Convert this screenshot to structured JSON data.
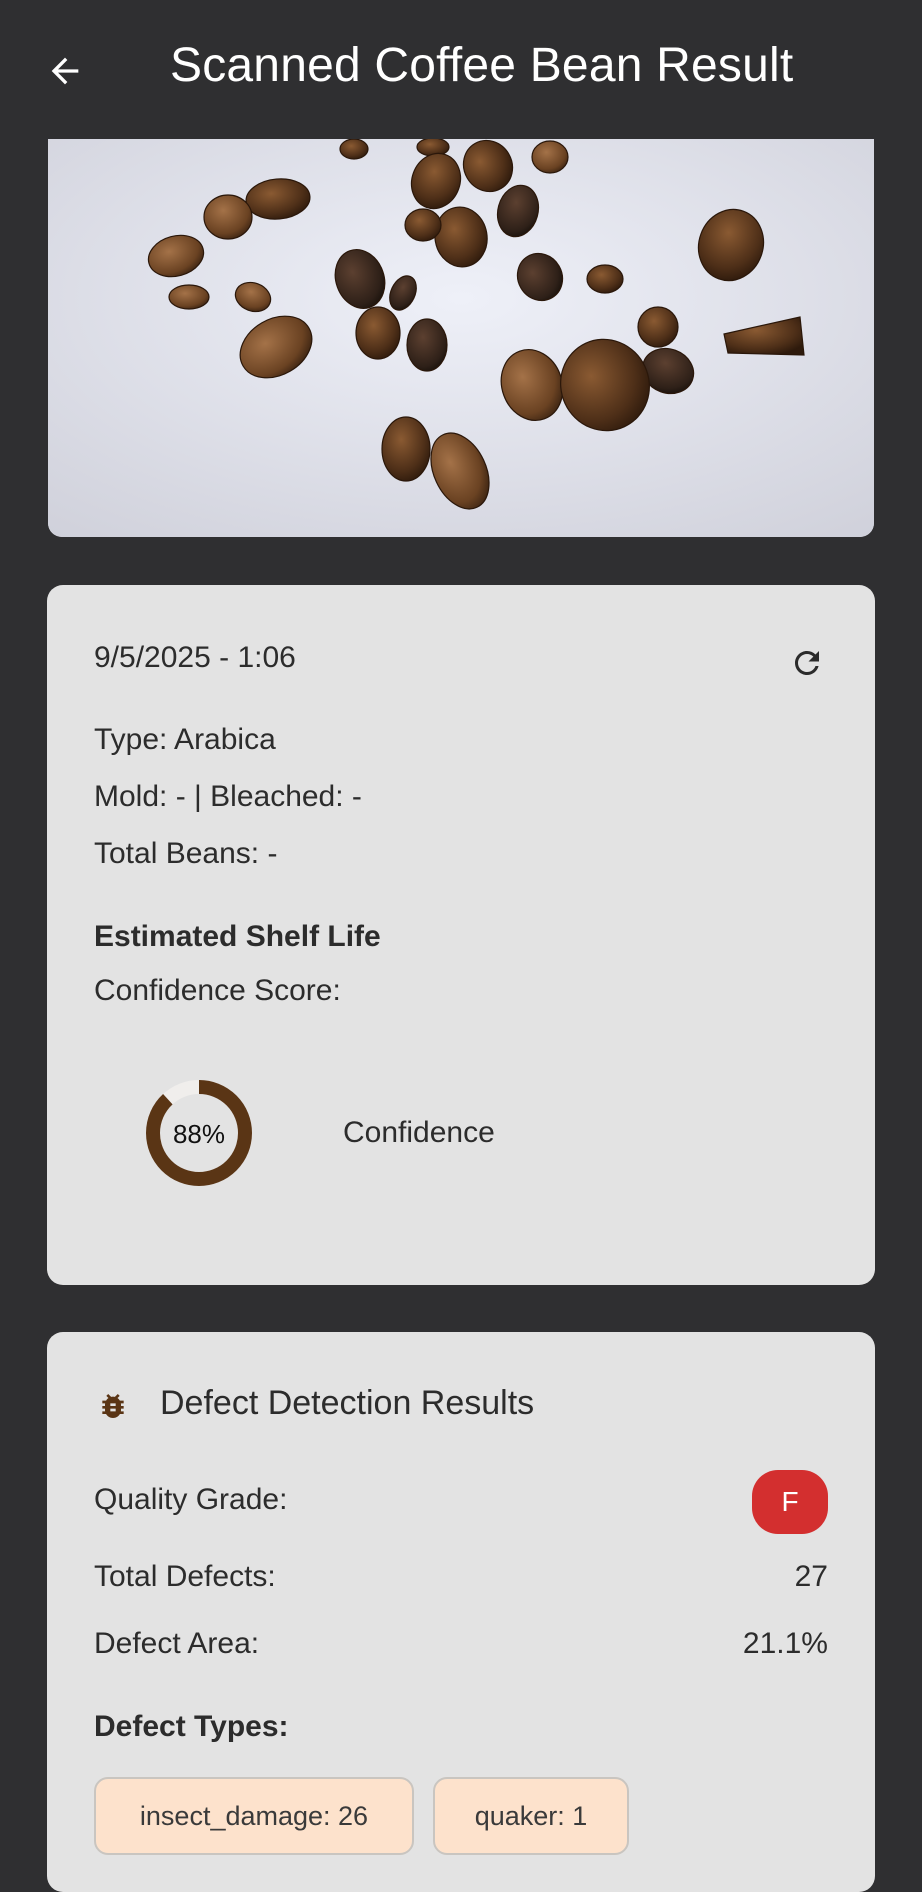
{
  "appbar": {
    "title": "Scanned Coffee Bean Result"
  },
  "scan_card": {
    "datetime": "9/5/2025 - 1:06",
    "type_line": "Type: Arabica",
    "mold_bleached_line": "Mold: - | Bleached: -",
    "total_beans_line": "Total Beans: -",
    "shelf_life_heading": "Estimated Shelf Life",
    "confidence_score_label": "Confidence Score:",
    "confidence_value": 0.88,
    "confidence_percent_text": "88%",
    "confidence_caption": "Confidence"
  },
  "defects_card": {
    "title": "Defect Detection Results",
    "quality_grade_label": "Quality Grade:",
    "quality_grade_value": "F",
    "total_defects_label": "Total Defects:",
    "total_defects_value": "27",
    "defect_area_label": "Defect Area:",
    "defect_area_value": "21.1%",
    "defect_types_heading": "Defect Types:",
    "chips": [
      "insect_damage: 26",
      "quaker: 1"
    ]
  },
  "colors": {
    "donut_fill": "#5a3515",
    "donut_track": "#f0eeec",
    "grade_badge": "#d32f2f",
    "chip_bg": "#fde2cc"
  },
  "icons": {
    "back": "arrow-left-icon",
    "refresh": "refresh-icon",
    "defects": "bug-icon"
  }
}
